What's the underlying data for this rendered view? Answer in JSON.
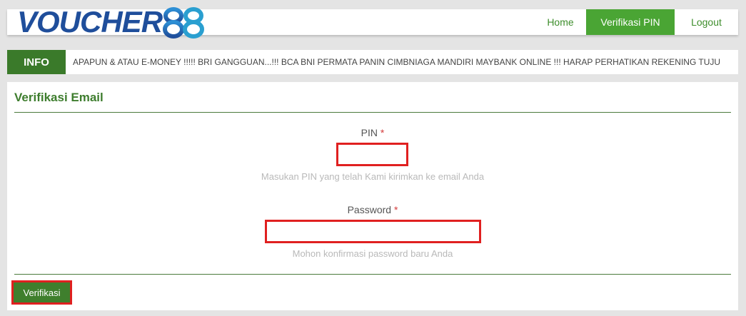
{
  "brand": {
    "logo_text": "VOUCHER",
    "logo_mark": "88"
  },
  "nav": {
    "home": "Home",
    "verifikasi_pin": "Verifikasi PIN",
    "logout": "Logout",
    "active": "verifikasi_pin"
  },
  "info": {
    "label": "INFO",
    "ticker": "APAPUN & ATAU E-MONEY !!!!! BRI GANGGUAN...!!! BCA BNI PERMATA PANIN CIMBNIAGA MANDIRI MAYBANK ONLINE !!! HARAP PERHATIKAN REKENING TUJU"
  },
  "form": {
    "title": "Verifikasi Email",
    "pin_label": "PIN",
    "pin_required": "*",
    "pin_value": "",
    "pin_help": "Masukan PIN yang telah Kami kirimkan ke email Anda",
    "password_label": "Password",
    "password_required": "*",
    "password_value": "",
    "password_help": "Mohon konfirmasi password baru Anda",
    "submit_label": "Verifikasi"
  },
  "colors": {
    "brand_green": "#3e8e2c",
    "active_nav": "#4aa534",
    "info_label_bg": "#3a7a2a",
    "highlight_red": "#e02020",
    "logo_blue": "#1f4e9b"
  }
}
